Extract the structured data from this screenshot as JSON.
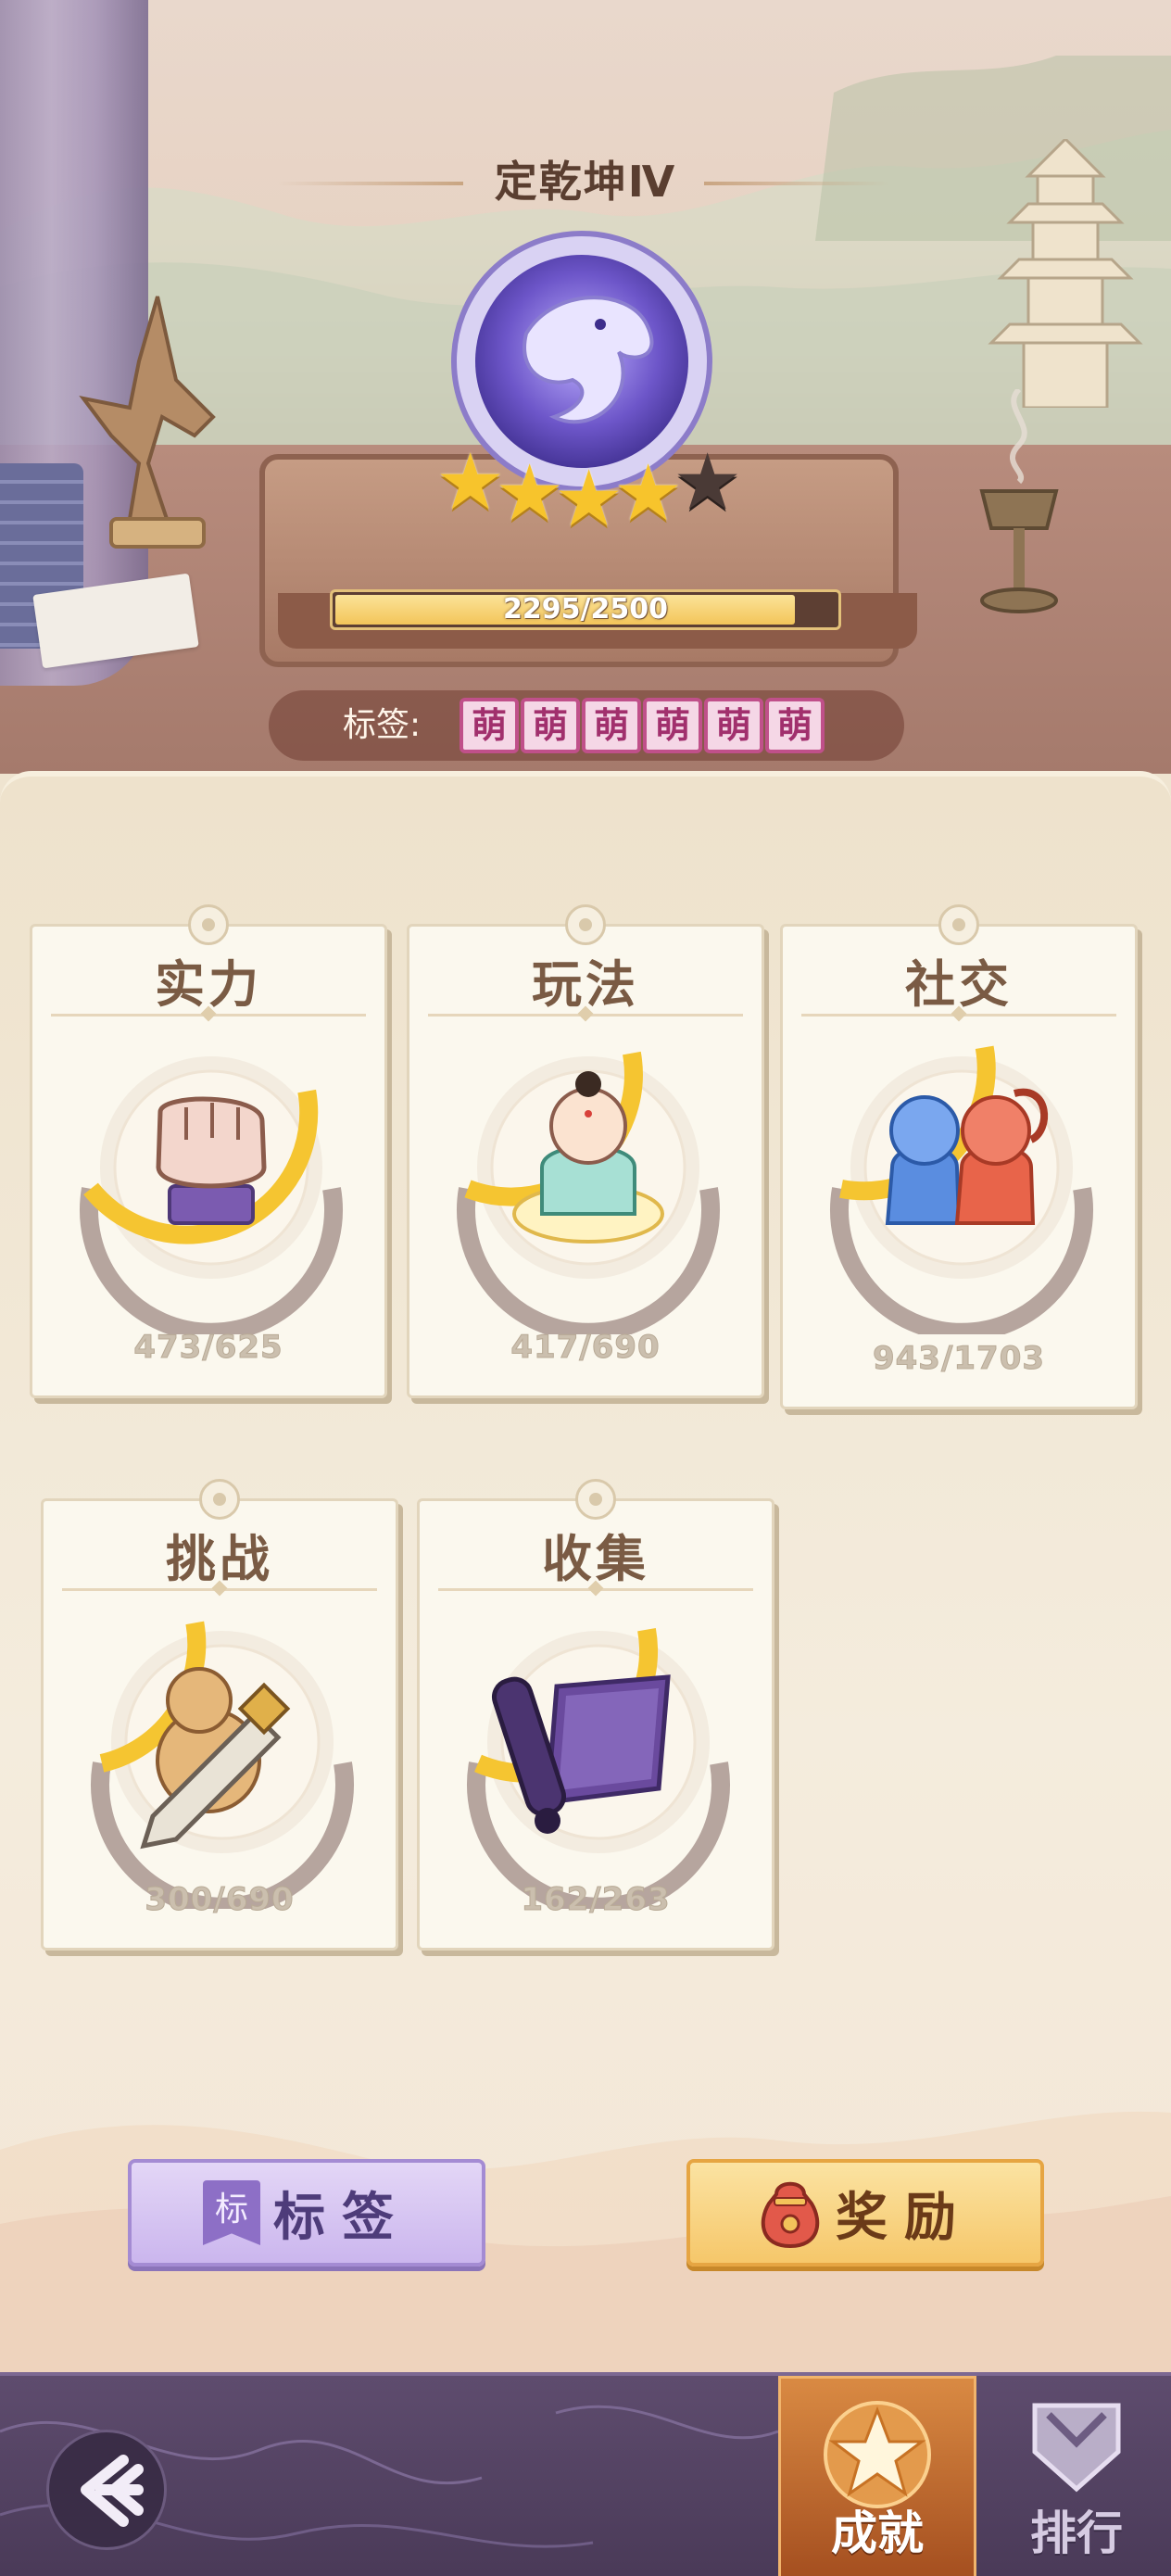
{
  "header": {
    "rank_title": "定乾坤Ⅳ",
    "stars_total": 5,
    "stars_earned": 4,
    "progress": {
      "current": 2295,
      "max": 2500,
      "text": "2295/2500"
    }
  },
  "tags": {
    "label": "标签:",
    "chips": [
      "萌",
      "萌",
      "萌",
      "萌",
      "萌",
      "萌"
    ]
  },
  "categories": [
    {
      "title": "实力",
      "value": "473/625",
      "fraction": 0.757,
      "icon": "fist-icon"
    },
    {
      "title": "玩法",
      "value": "417/690",
      "fraction": 0.604,
      "icon": "monk-icon"
    },
    {
      "title": "社交",
      "value": "943/1703",
      "fraction": 0.554,
      "icon": "couple-icon"
    },
    {
      "title": "挑战",
      "value": "300/690",
      "fraction": 0.435,
      "icon": "gourd-sword-icon"
    },
    {
      "title": "收集",
      "value": "162/263",
      "fraction": 0.616,
      "icon": "scroll-icon"
    }
  ],
  "buttons": {
    "tag_badge": "标",
    "tag_label": "标签",
    "reward_label": "奖励"
  },
  "nav": {
    "back_icon": "back-arrow-icon",
    "achievement_label": "成就",
    "ranking_label": "排行"
  },
  "colors": {
    "gauge_fill": "#f5c531",
    "gauge_track": "#b6a59e",
    "tag_chip_border": "#c0508a",
    "active_tab": "#c86a2f"
  }
}
